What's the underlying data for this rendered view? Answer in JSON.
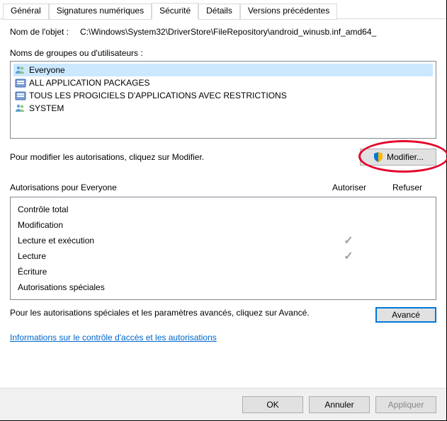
{
  "tabs": {
    "general": "Général",
    "signatures": "Signatures numériques",
    "security": "Sécurité",
    "details": "Détails",
    "previous": "Versions précédentes"
  },
  "object": {
    "label": "Nom de l'objet :",
    "path": "C:\\Windows\\System32\\DriverStore\\FileRepository\\android_winusb.inf_amd64_"
  },
  "groups": {
    "label": "Noms de groupes ou d'utilisateurs :",
    "items": [
      {
        "name": "Everyone",
        "selected": true,
        "icon": "group"
      },
      {
        "name": "ALL APPLICATION PACKAGES",
        "selected": false,
        "icon": "pkg"
      },
      {
        "name": "TOUS LES PROGICIELS D'APPLICATIONS AVEC RESTRICTIONS",
        "selected": false,
        "icon": "pkg"
      },
      {
        "name": "SYSTEM",
        "selected": false,
        "icon": "group"
      }
    ]
  },
  "modify": {
    "hint": "Pour modifier les autorisations, cliquez sur Modifier.",
    "button": "Modifier..."
  },
  "permissions": {
    "title": "Autorisations pour Everyone",
    "col_allow": "Autoriser",
    "col_deny": "Refuser",
    "rows": [
      {
        "name": "Contrôle total",
        "allow": false,
        "deny": false
      },
      {
        "name": "Modification",
        "allow": false,
        "deny": false
      },
      {
        "name": "Lecture et exécution",
        "allow": true,
        "deny": false
      },
      {
        "name": "Lecture",
        "allow": true,
        "deny": false
      },
      {
        "name": "Écriture",
        "allow": false,
        "deny": false
      },
      {
        "name": "Autorisations spéciales",
        "allow": false,
        "deny": false
      }
    ]
  },
  "advanced": {
    "hint": "Pour les autorisations spéciales et les paramètres avancés, cliquez sur Avancé.",
    "button": "Avancé"
  },
  "link": "Informations sur le contrôle d'accès et les autorisations",
  "footer": {
    "ok": "OK",
    "cancel": "Annuler",
    "apply": "Appliquer"
  }
}
